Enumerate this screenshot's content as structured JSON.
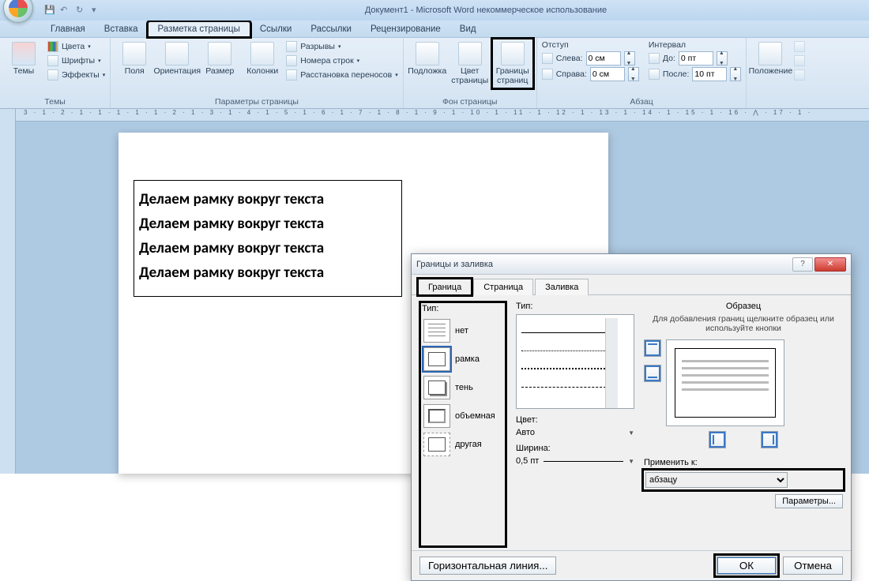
{
  "window": {
    "title": "Документ1 - Microsoft Word некоммерческое использование"
  },
  "tabs": {
    "items": [
      "Главная",
      "Вставка",
      "Разметка страницы",
      "Ссылки",
      "Рассылки",
      "Рецензирование",
      "Вид"
    ],
    "activeIndex": 2
  },
  "ribbon": {
    "themes": {
      "label": "Темы",
      "btn": "Темы",
      "colors": "Цвета",
      "fonts": "Шрифты",
      "effects": "Эффекты"
    },
    "pageSetup": {
      "label": "Параметры страницы",
      "margins": "Поля",
      "orientation": "Ориентация",
      "size": "Размер",
      "columns": "Колонки",
      "breaks": "Разрывы",
      "lineNumbers": "Номера строк",
      "hyphenation": "Расстановка переносов"
    },
    "pageBg": {
      "label": "Фон страницы",
      "watermark": "Подложка",
      "pageColor": "Цвет страницы",
      "borders": "Границы страниц"
    },
    "paragraph": {
      "label": "Абзац",
      "indentHdr": "Отступ",
      "spacingHdr": "Интервал",
      "left": "Слева:",
      "right": "Справа:",
      "before": "До:",
      "after": "После:",
      "leftVal": "0 см",
      "rightVal": "0 см",
      "beforeVal": "0 пт",
      "afterVal": "10 пт"
    },
    "arrange": {
      "label": "",
      "position": "Положение"
    }
  },
  "ruler": "3 · 1 · 2 · 1 · 1 · 1 ·        1 · 1 · 2 · 1 · 3 · 1 · 4 · 1 · 5 · 1 · 6 · 1 · 7 · 1 · 8 · 1 · 9 · 1 · 10 · 1 · 11 · 1 · 12 · 1 · 13 · 1 · 14 · 1 · 15 · 1 · 16 · ⋀ · 17 · 1 ·",
  "document": {
    "paragraphs": [
      "Делаем рамку вокруг текста",
      "Делаем рамку вокруг текста",
      "Делаем рамку вокруг текста",
      "Делаем рамку вокруг текста"
    ]
  },
  "dialog": {
    "title": "Границы и заливка",
    "tabs": [
      "Граница",
      "Страница",
      "Заливка"
    ],
    "activeTab": 0,
    "typeHdr": "Тип:",
    "types": {
      "none": "нет",
      "box": "рамка",
      "shadow": "тень",
      "threed": "объемная",
      "other": "другая"
    },
    "styleHdr": "Тип:",
    "colorHdr": "Цвет:",
    "colorVal": "Авто",
    "widthHdr": "Ширина:",
    "widthVal": "0,5 пт",
    "sampleHdr": "Образец",
    "sampleHint": "Для добавления границ щелкните образец или используйте кнопки",
    "applyHdr": "Применить к:",
    "applyVal": "абзацу",
    "paramsBtn": "Параметры...",
    "hlineBtn": "Горизонтальная линия...",
    "ok": "ОК",
    "cancel": "Отмена"
  }
}
